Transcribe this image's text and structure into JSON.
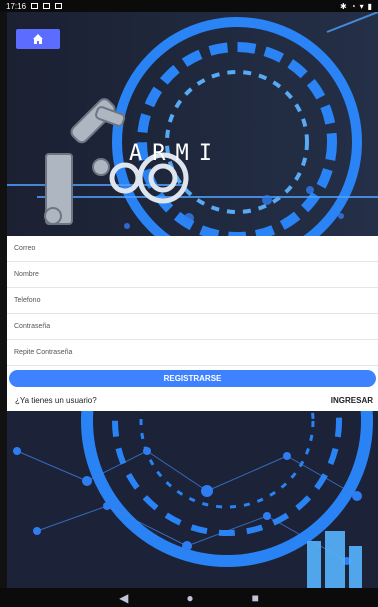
{
  "status": {
    "time": "17:16"
  },
  "app": {
    "brand": "ARMI"
  },
  "form": {
    "fields": [
      {
        "label": "Correo"
      },
      {
        "label": "Nombre"
      },
      {
        "label": "Telefono"
      },
      {
        "label": "Contraseña"
      },
      {
        "label": "Repite Contraseña"
      }
    ],
    "register_label": "REGISTRARSE",
    "question": "¿Ya tienes un usuario?",
    "login_label": "INGRESAR"
  },
  "nav": {
    "back": "◀",
    "home": "●",
    "recent": "■"
  },
  "colors": {
    "accent": "#3f82ff",
    "home_button": "#5b6cff",
    "background_dark": "#1f2336"
  }
}
